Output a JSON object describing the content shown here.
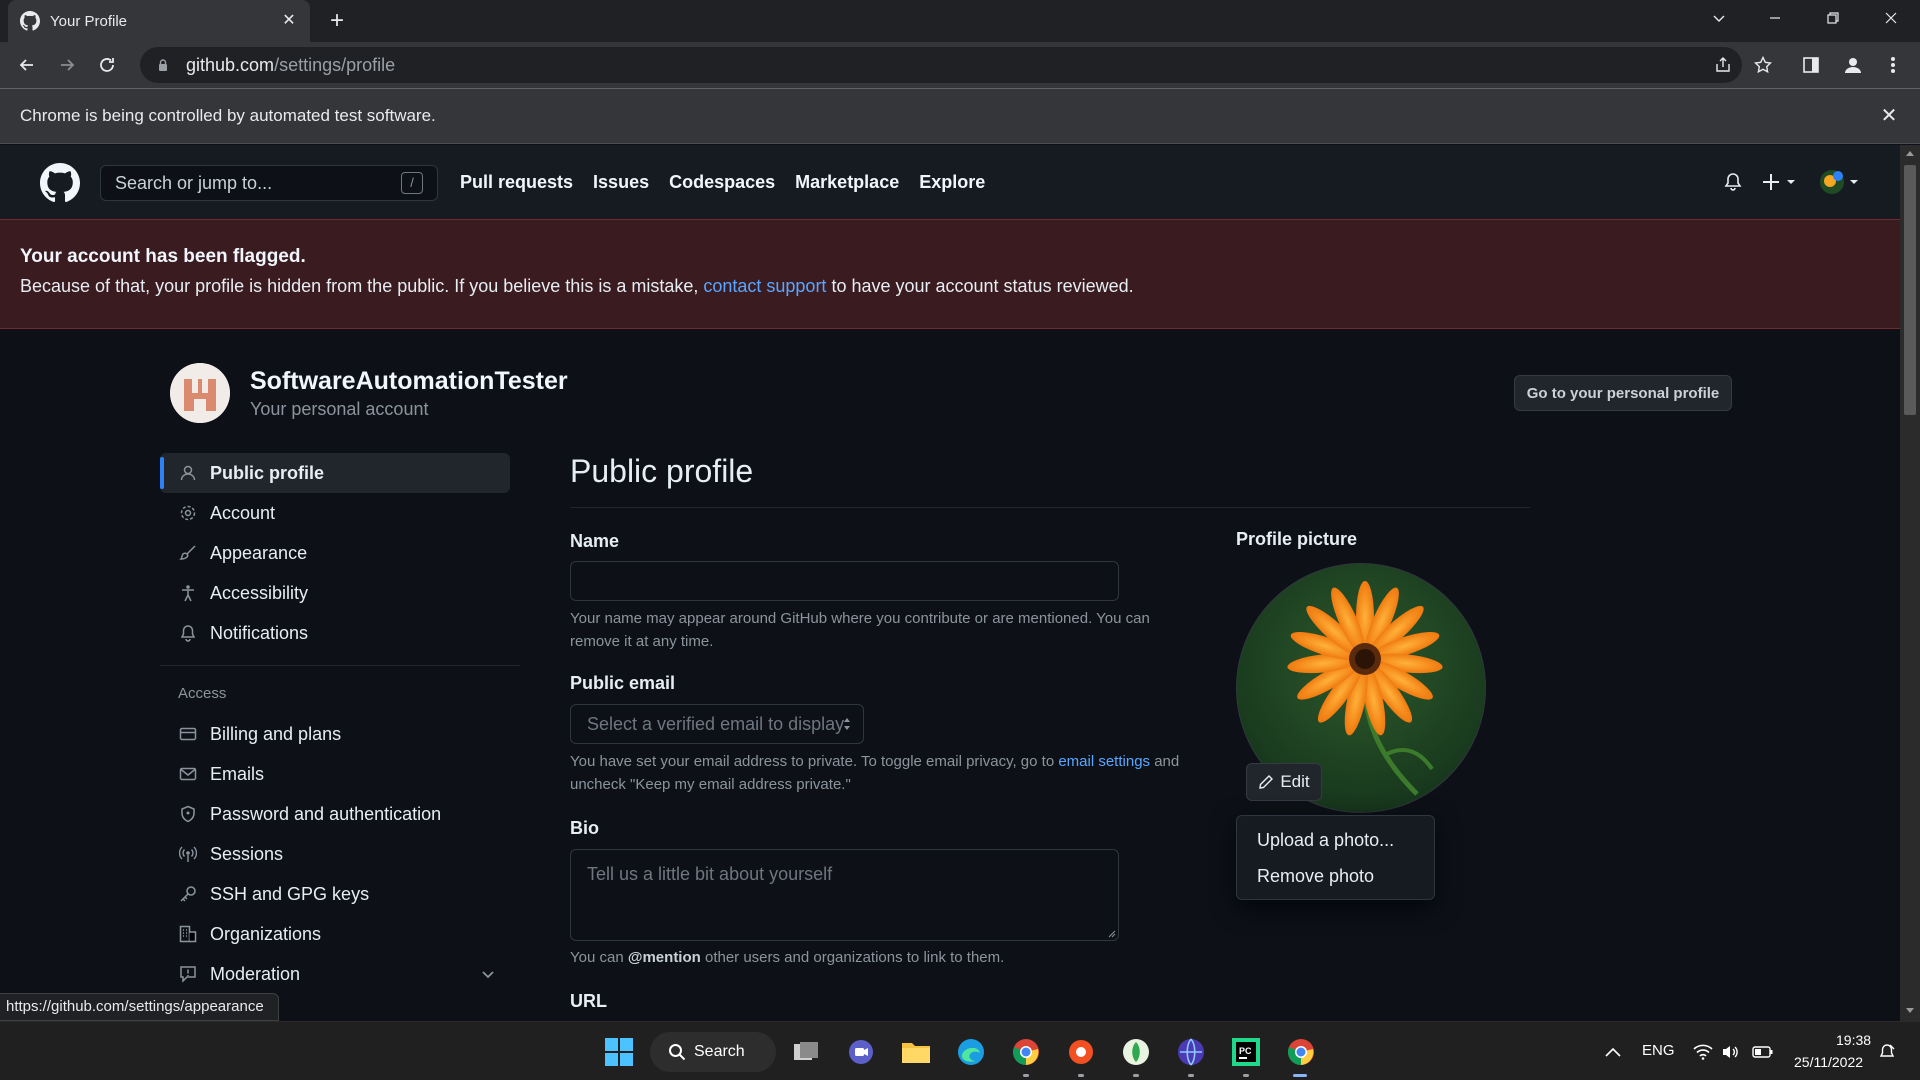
{
  "browser": {
    "tab_title": "Your Profile",
    "url_host": "github.com",
    "url_path": "/settings/profile",
    "infobar_text": "Chrome is being controlled by automated test software.",
    "status_url": "https://github.com/settings/appearance"
  },
  "header": {
    "search_placeholder": "Search or jump to...",
    "search_shortcut": "/",
    "nav": [
      "Pull requests",
      "Issues",
      "Codespaces",
      "Marketplace",
      "Explore"
    ]
  },
  "flag": {
    "title": "Your account has been flagged.",
    "text_before": "Because of that, your profile is hidden from the public. If you believe this is a mistake, ",
    "link": "contact support",
    "text_after": " to have your account status reviewed."
  },
  "account": {
    "name": "SoftwareAutomationTester",
    "subtitle": "Your personal account",
    "profile_button": "Go to your personal profile"
  },
  "sidebar": {
    "items": [
      {
        "label": "Public profile",
        "icon": "person-icon"
      },
      {
        "label": "Account",
        "icon": "gear-icon"
      },
      {
        "label": "Appearance",
        "icon": "paintbrush-icon"
      },
      {
        "label": "Accessibility",
        "icon": "accessibility-icon"
      },
      {
        "label": "Notifications",
        "icon": "bell-icon"
      }
    ],
    "access_heading": "Access",
    "access_items": [
      {
        "label": "Billing and plans",
        "icon": "credit-card-icon"
      },
      {
        "label": "Emails",
        "icon": "mail-icon"
      },
      {
        "label": "Password and authentication",
        "icon": "shield-icon"
      },
      {
        "label": "Sessions",
        "icon": "broadcast-icon"
      },
      {
        "label": "SSH and GPG keys",
        "icon": "key-icon"
      },
      {
        "label": "Organizations",
        "icon": "organization-icon"
      },
      {
        "label": "Moderation",
        "icon": "report-icon"
      }
    ]
  },
  "main": {
    "title": "Public profile",
    "name_label": "Name",
    "name_value": "",
    "name_hint": "Your name may appear around GitHub where you contribute or are mentioned. You can remove it at any time.",
    "email_label": "Public email",
    "email_select": "Select a verified email to display",
    "email_hint_before": "You have set your email address to private. To toggle email privacy, go to ",
    "email_hint_link": "email settings",
    "email_hint_after": " and uncheck \"Keep my email address private.\"",
    "bio_label": "Bio",
    "bio_placeholder": "Tell us a little bit about yourself",
    "bio_hint_before": "You can ",
    "bio_hint_mention": "@mention",
    "bio_hint_after": " other users and organizations to link to them.",
    "url_label": "URL"
  },
  "profile_picture": {
    "label": "Profile picture",
    "edit_label": "Edit",
    "menu": [
      "Upload a photo...",
      "Remove photo"
    ]
  },
  "taskbar": {
    "search_label": "Search",
    "lang": "ENG",
    "time": "19:38",
    "date": "25/11/2022"
  },
  "colors": {
    "accent": "#2f81f7",
    "link": "#58a6ff",
    "flag_bg": "#3a1c20",
    "page_bg": "#0d1117"
  }
}
